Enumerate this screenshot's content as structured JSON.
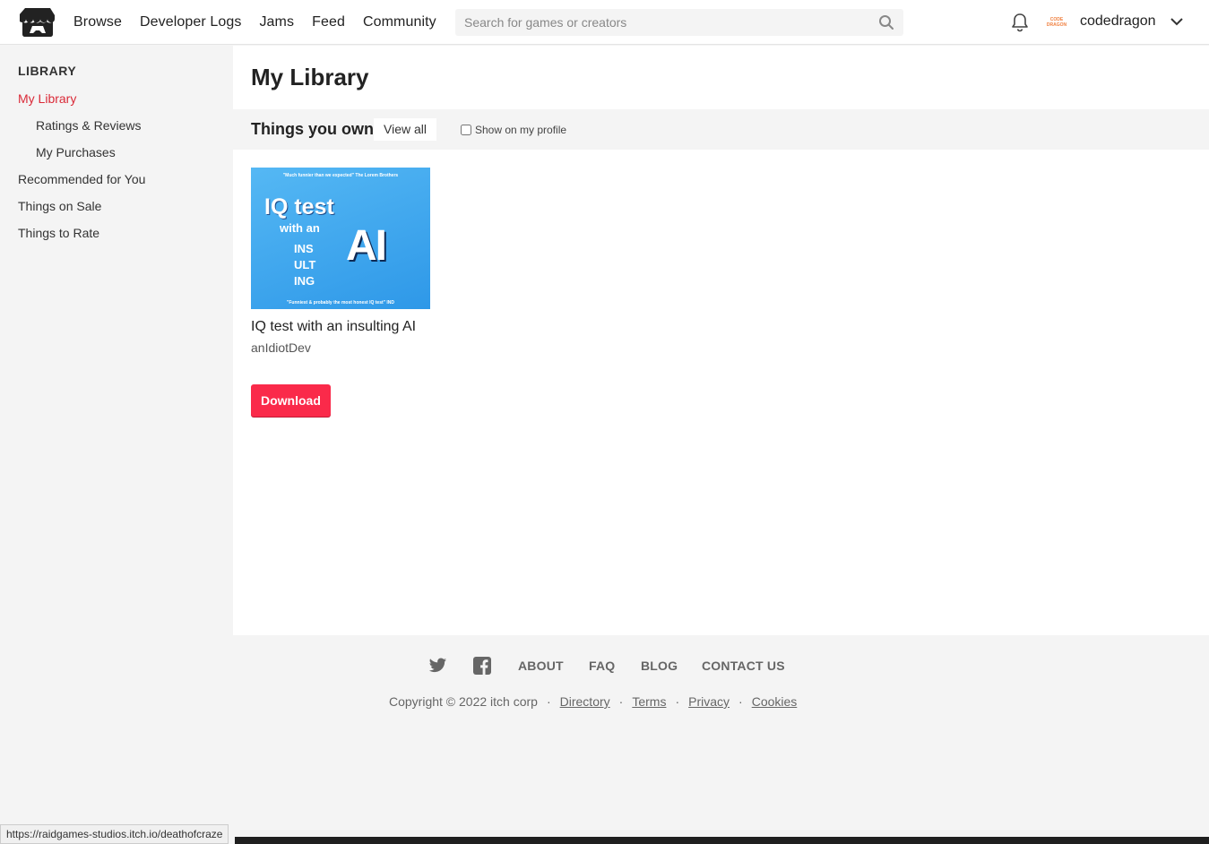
{
  "header": {
    "nav": [
      "Browse",
      "Developer Logs",
      "Jams",
      "Feed",
      "Community"
    ],
    "search_placeholder": "Search for games or creators",
    "username": "codedragon",
    "avatar_text": [
      "CODE",
      "DRAGON"
    ]
  },
  "sidebar": {
    "title": "LIBRARY",
    "items": [
      {
        "label": "My Library",
        "active": true
      },
      {
        "label": "Ratings & Reviews"
      },
      {
        "label": "My Purchases"
      },
      {
        "label": "Recommended for You"
      },
      {
        "label": "Things on Sale"
      },
      {
        "label": "Things to Rate"
      }
    ]
  },
  "main": {
    "title": "My Library",
    "section_title": "Things you own",
    "view_all": "View all",
    "show_on_profile": "Show on my profile",
    "game": {
      "cover": {
        "quote_top": "\"Much funnier than we expected\" The Lorem Brothers",
        "title_line1": "IQ test",
        "title_line2": "with an",
        "title_line3": [
          "INS",
          "ULT",
          "ING"
        ],
        "title_big": "AI",
        "quote_bottom": "\"Funniest & probably the most honest IQ test\" IND"
      },
      "title": "IQ test with an insulting AI",
      "author": "anIdiotDev",
      "download_label": "Download"
    }
  },
  "footer": {
    "links": [
      "ABOUT",
      "FAQ",
      "BLOG",
      "CONTACT US"
    ],
    "copyright": "Copyright © 2022 itch corp",
    "legal": [
      "Directory",
      "Terms",
      "Privacy",
      "Cookies"
    ]
  },
  "status_url": "https://raidgames-studios.itch.io/deathofcraze",
  "colors": {
    "accent": "#fa2a4a",
    "active_link": "#da2a38"
  }
}
